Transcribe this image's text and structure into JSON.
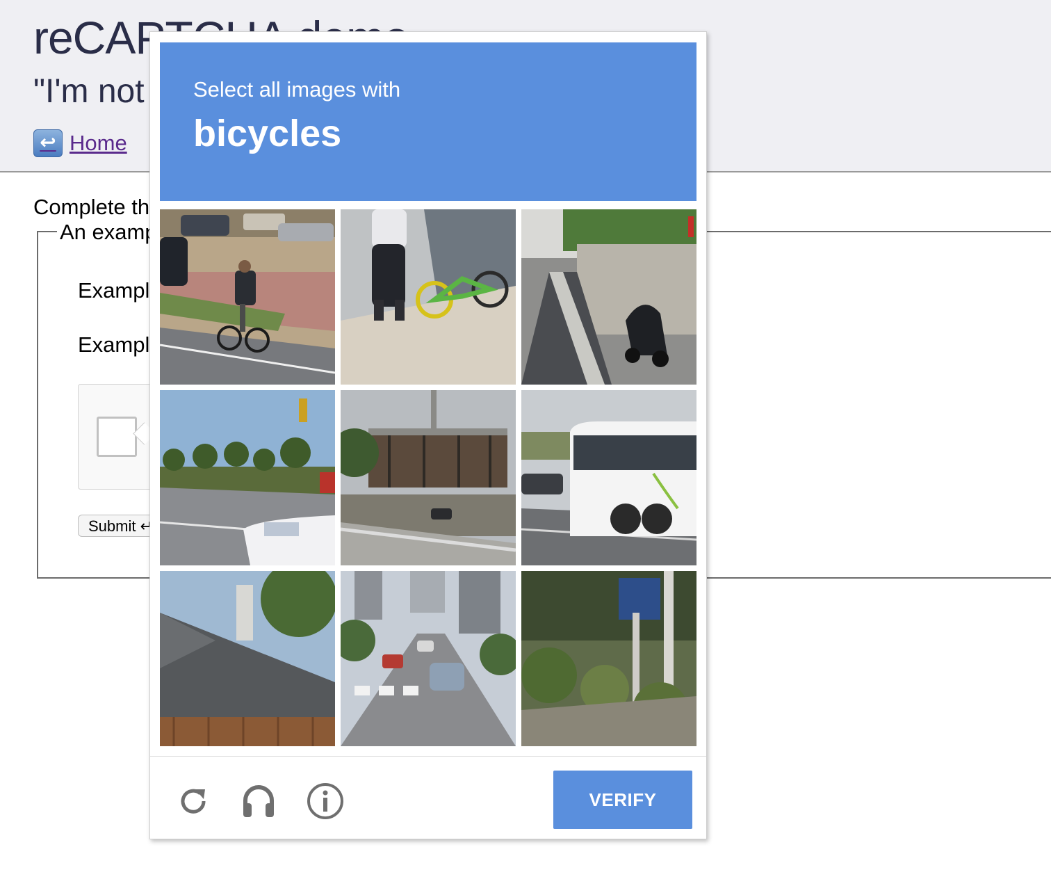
{
  "page": {
    "title": "reCAPTCHA demo",
    "subtitle": "\"I'm not",
    "home_link": "Home",
    "instructions": "Complete th",
    "legend": "An examp",
    "field1_label": "Exampl",
    "field2_label": "Exampl",
    "submit_label": "Submit ↵"
  },
  "challenge": {
    "prompt": "Select all images with",
    "keyword": "bicycles",
    "tiles": [
      "cyclist-on-road",
      "green-bicycle-and-pedestrian",
      "motorcycle-by-wall",
      "palm-trees-street",
      "construction-site",
      "white-bus",
      "house-roof",
      "city-street-crosswalk",
      "garden-plants"
    ],
    "verify_label": "VERIFY",
    "footer_icons": [
      "reload-icon",
      "audio-icon",
      "info-icon"
    ],
    "accent_color": "#5a8fdd"
  }
}
